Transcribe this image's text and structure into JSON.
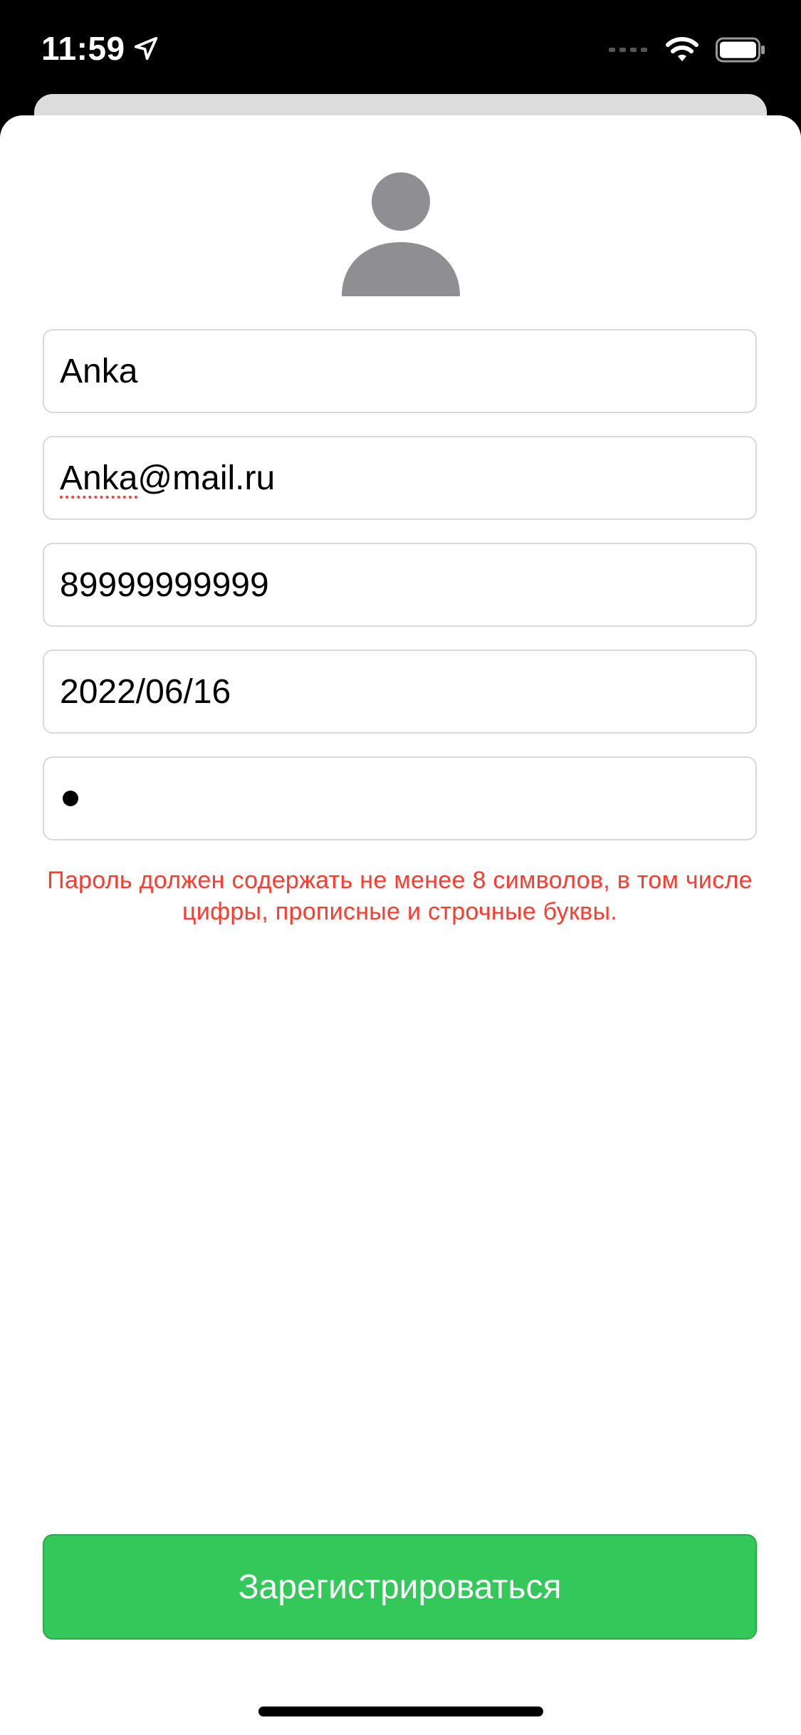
{
  "status_bar": {
    "time": "11:59",
    "location_icon": "location-arrow-icon",
    "signal_icon": "cellular-signal-icon",
    "wifi_icon": "wifi-icon",
    "battery_icon": "battery-icon"
  },
  "profile": {
    "avatar_icon": "person-placeholder-icon"
  },
  "form": {
    "name_value": "Anka",
    "email_value_user": "Anka",
    "email_value_domain": "@mail.ru",
    "phone_value": "89999999999",
    "birthdate_value": "2022/06/16",
    "password_masked_length": 1,
    "password_error": "Пароль должен содержать не менее 8 символов, в том числе цифры, прописные и строчные буквы."
  },
  "actions": {
    "register_label": "Зарегистрироваться"
  },
  "colors": {
    "accent_green": "#34c759",
    "error_red": "#ff3b30",
    "avatar_gray": "#8e8e93"
  }
}
